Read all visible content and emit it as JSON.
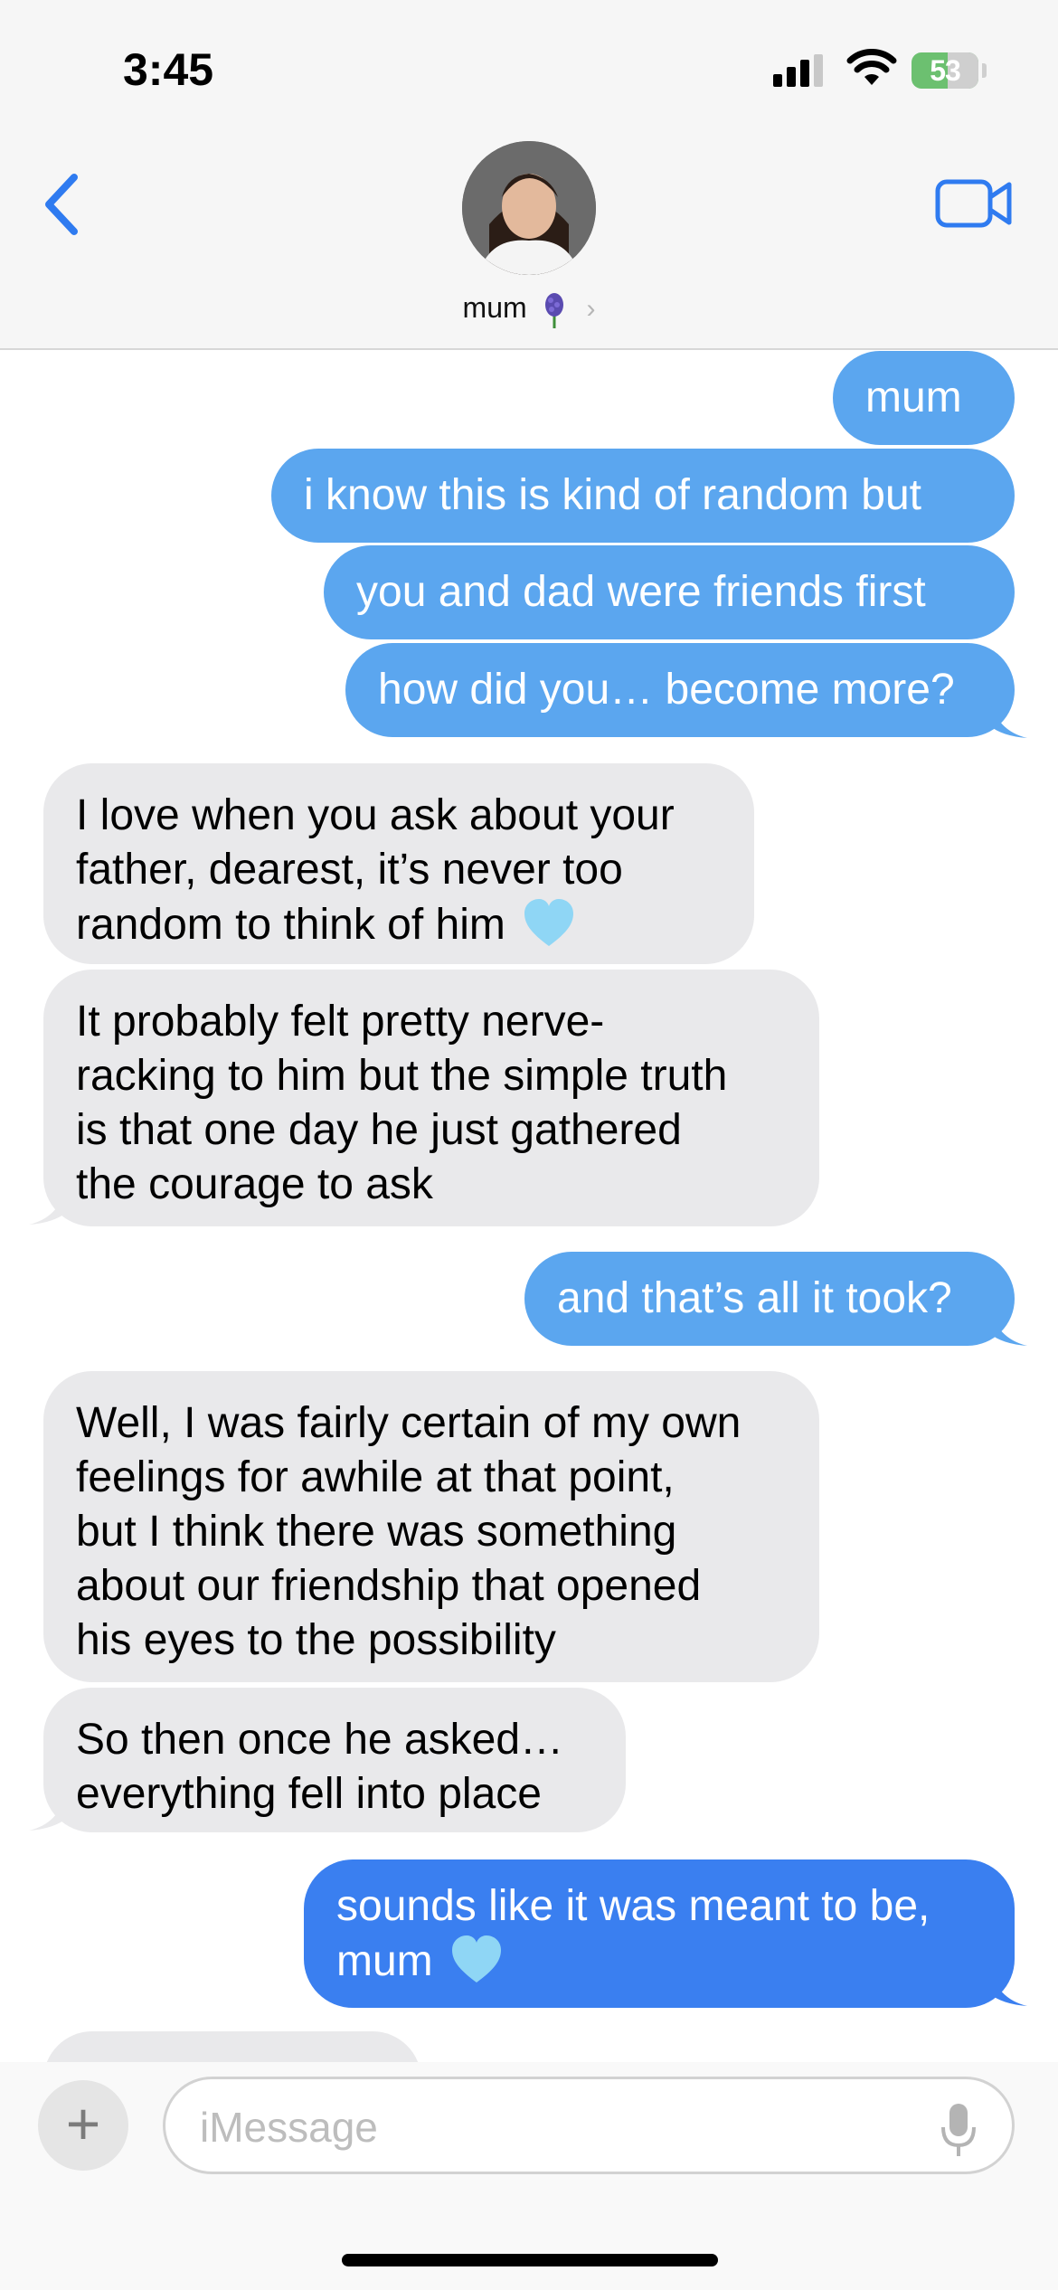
{
  "status": {
    "time": "3:45",
    "battery": "53",
    "signal_bars": 3,
    "signal_bars_max": 4
  },
  "header": {
    "contact_name": "mum",
    "flower": "hyacinth-emoji",
    "back": "chevron-left-icon",
    "video": "video-icon"
  },
  "colors": {
    "sent": "#5ba6ef",
    "sent_last": "#3a7ff0",
    "received": "#e9e9eb",
    "accent": "#2f7bf0"
  },
  "messages": [
    {
      "dir": "out",
      "text": "mum"
    },
    {
      "dir": "out",
      "text": "i know this is kind of random but"
    },
    {
      "dir": "out",
      "text": "you and dad were friends first"
    },
    {
      "dir": "out",
      "text": "how did you… become more?"
    },
    {
      "dir": "in",
      "lines": [
        "I love when you ask about your",
        "father, dearest, it’s never too",
        "random to think of him"
      ],
      "emoji": "light-blue-heart"
    },
    {
      "dir": "in",
      "lines": [
        "It probably felt pretty nerve-",
        "racking to him but the simple truth",
        "is that one day he just gathered",
        "the courage to ask"
      ]
    },
    {
      "dir": "out",
      "text": "and that’s all it took?"
    },
    {
      "dir": "in",
      "lines": [
        "Well, I was fairly certain of my own",
        "feelings for awhile at that point,",
        "but I think there was something",
        "about our friendship that opened",
        "his eyes to the possibility"
      ]
    },
    {
      "dir": "in",
      "lines": [
        "So then once he asked…",
        "everything fell into place"
      ]
    },
    {
      "dir": "out",
      "lines": [
        "sounds like it was meant to be,",
        "mum"
      ],
      "emoji": "light-blue-heart"
    }
  ],
  "composer": {
    "placeholder": "iMessage",
    "plus": "plus-icon",
    "mic": "microphone-icon"
  }
}
